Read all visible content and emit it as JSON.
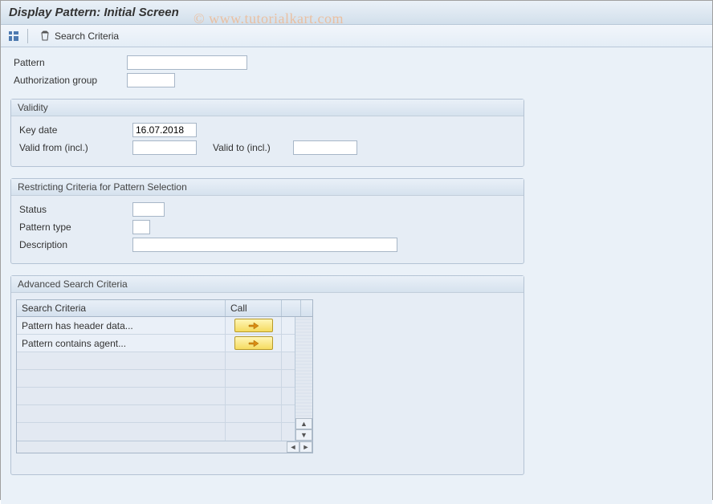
{
  "title": "Display Pattern: Initial Screen",
  "watermark": "© www.tutorialkart.com",
  "toolbar": {
    "search_btn": "Search Criteria"
  },
  "fields": {
    "pattern_label": "Pattern",
    "pattern_value": "",
    "authgrp_label": "Authorization group",
    "authgrp_value": ""
  },
  "validity": {
    "group_title": "Validity",
    "keydate_label": "Key date",
    "keydate_value": "16.07.2018",
    "valid_from_label": "Valid from (incl.)",
    "valid_from_value": "",
    "valid_to_label": "Valid to (incl.)",
    "valid_to_value": ""
  },
  "restricting": {
    "group_title": "Restricting Criteria for Pattern Selection",
    "status_label": "Status",
    "status_value": "",
    "ptype_label": "Pattern type",
    "ptype_value": "",
    "desc_label": "Description",
    "desc_value": ""
  },
  "advanced": {
    "group_title": "Advanced Search Criteria",
    "col_sc": "Search Criteria",
    "col_call": "Call",
    "rows": [
      {
        "label": "Pattern has header data..."
      },
      {
        "label": "Pattern contains agent..."
      }
    ]
  }
}
